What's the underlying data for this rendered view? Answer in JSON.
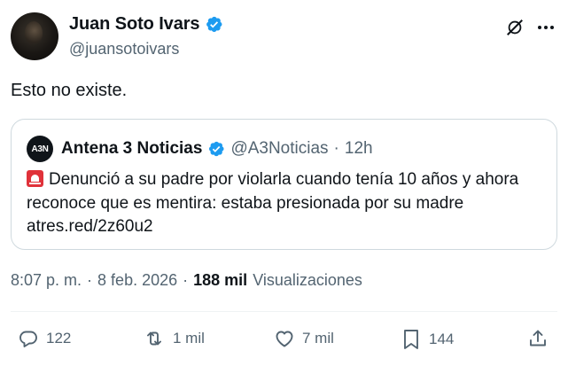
{
  "author": {
    "display_name": "Juan Soto Ivars",
    "handle": "@juansotoivars",
    "verified": true
  },
  "tweet": {
    "text": "Esto no existe."
  },
  "quote": {
    "avatar_text": "A3N",
    "display_name": "Antena 3 Noticias",
    "handle": "@A3Noticias",
    "separator": "·",
    "time": "12h",
    "verified": true,
    "emoji": "rotating-light",
    "text": "Denunció a su padre por violarla cuando tenía 10 años y ahora reconoce que es mentira: estaba presionada por su madre atres.red/2z60u2"
  },
  "meta": {
    "time": "8:07 p. m.",
    "separator": "·",
    "date": "8 feb. 2026",
    "separator2": "·",
    "views_count": "188 mil",
    "views_label": "Visualizaciones"
  },
  "actions": {
    "replies": "122",
    "reposts": "1 mil",
    "likes": "7 mil",
    "bookmarks": "144"
  },
  "colors": {
    "text": "#0f1419",
    "secondary": "#536471",
    "verified": "#1d9bf0",
    "border": "#cfd9de"
  }
}
